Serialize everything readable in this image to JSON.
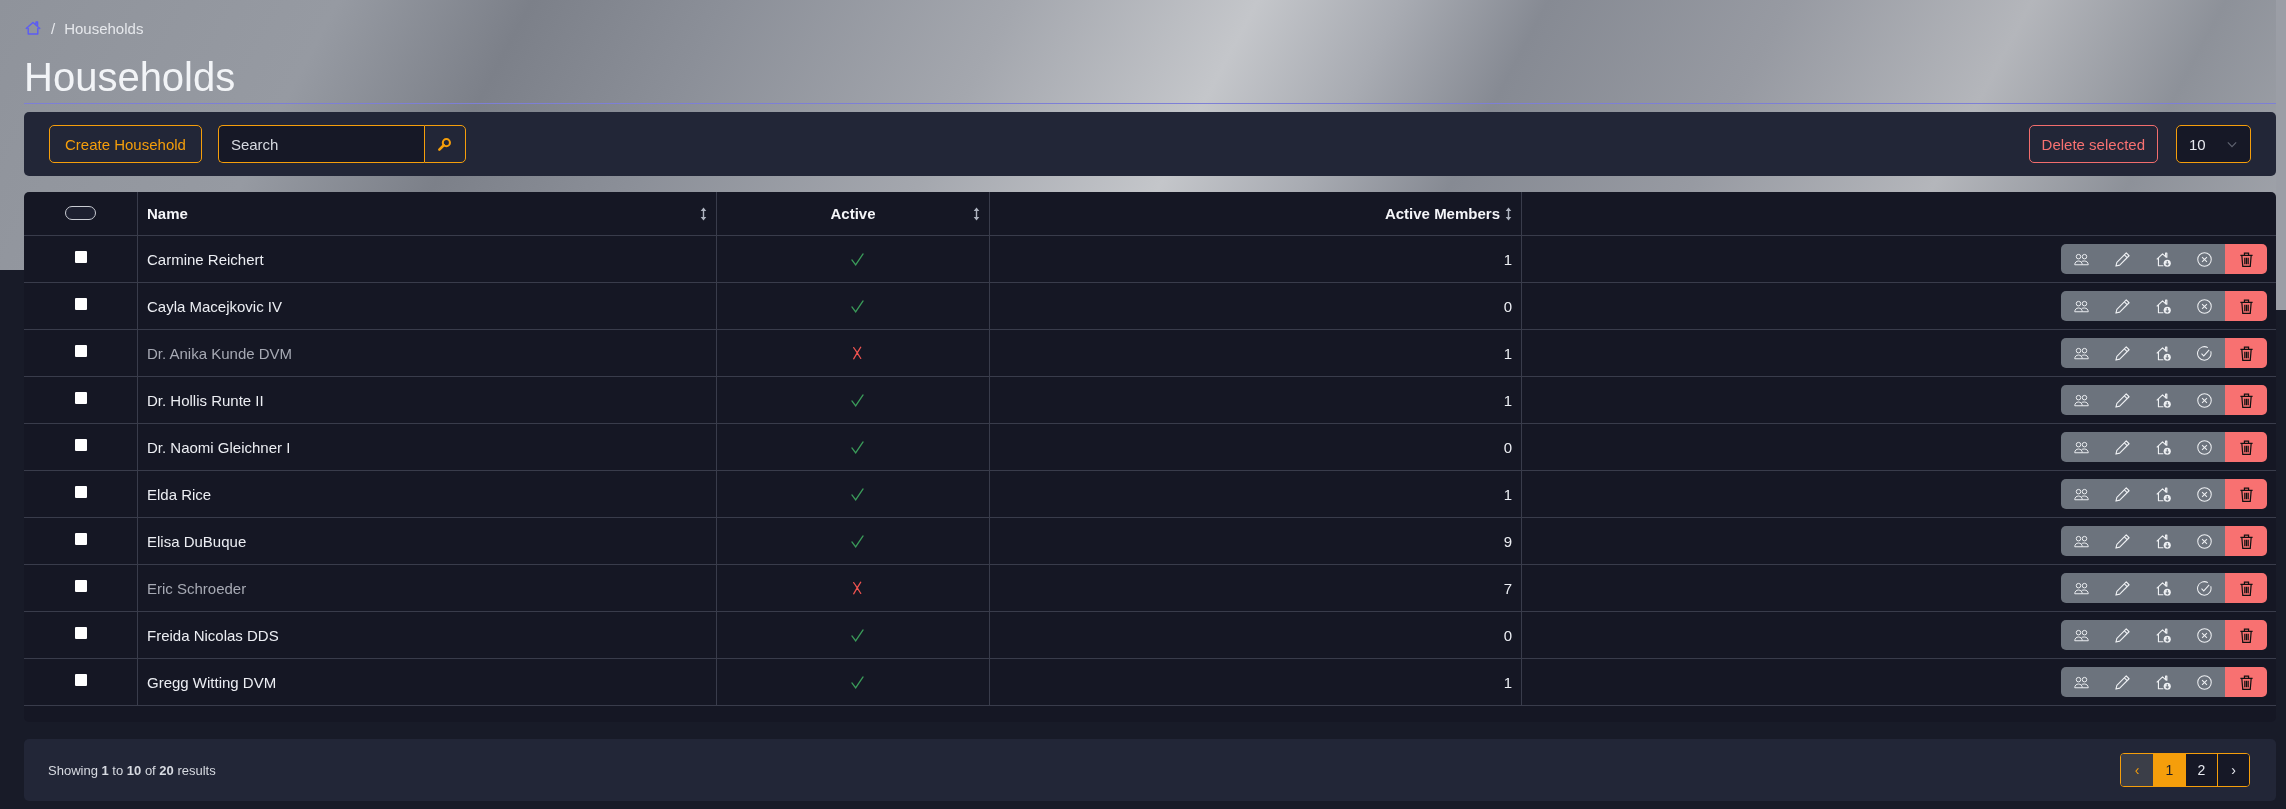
{
  "breadcrumb": {
    "separator": "/",
    "items": [
      {
        "label": "Households"
      }
    ]
  },
  "title": "Households",
  "toolbar": {
    "create_button": "Create Household",
    "search": {
      "placeholder": "Search"
    },
    "delete_button": "Delete selected",
    "page_size": "10"
  },
  "table": {
    "select_all": {
      "checked": false
    },
    "columns": [
      {
        "label": "Name",
        "sortable": true
      },
      {
        "label": "Active",
        "sortable": true
      },
      {
        "label": "Active Members",
        "sortable": true
      }
    ],
    "rows": [
      {
        "checked": false,
        "name": "Carmine Reichert",
        "active": true,
        "active_members": "1"
      },
      {
        "checked": false,
        "name": "Cayla Macejkovic IV",
        "active": true,
        "active_members": "0"
      },
      {
        "checked": false,
        "name": "Dr. Anika Kunde DVM",
        "active": false,
        "active_members": "1"
      },
      {
        "checked": false,
        "name": "Dr. Hollis Runte II",
        "active": true,
        "active_members": "1"
      },
      {
        "checked": false,
        "name": "Dr. Naomi Gleichner I",
        "active": true,
        "active_members": "0"
      },
      {
        "checked": false,
        "name": "Elda Rice",
        "active": true,
        "active_members": "1"
      },
      {
        "checked": false,
        "name": "Elisa DuBuque",
        "active": true,
        "active_members": "9"
      },
      {
        "checked": false,
        "name": "Eric Schroeder",
        "active": false,
        "active_members": "7"
      },
      {
        "checked": false,
        "name": "Freida Nicolas DDS",
        "active": true,
        "active_members": "0"
      },
      {
        "checked": false,
        "name": "Gregg Witting DVM",
        "active": true,
        "active_members": "1"
      }
    ]
  },
  "pagination": {
    "summary": "Showing **1** to **10** of **20** results",
    "prev": {
      "label": "‹",
      "disabled": true
    },
    "pages": [
      {
        "label": "1",
        "selected": true
      },
      {
        "label": "2",
        "selected": false
      }
    ],
    "next": {
      "label": "›",
      "disabled": false
    }
  }
}
